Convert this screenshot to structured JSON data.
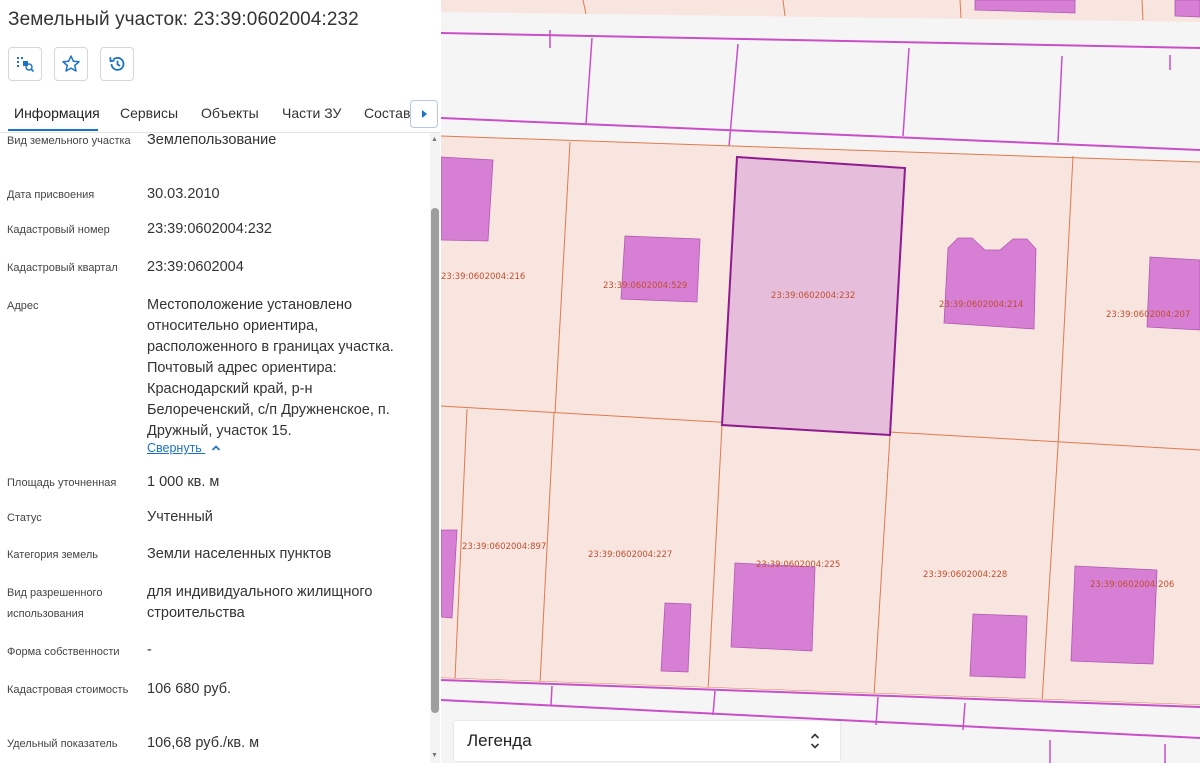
{
  "panel": {
    "title": "Земельный участок: 23:39:0602004:232",
    "tools": [
      {
        "icon": "zoom-to-object-icon"
      },
      {
        "icon": "star-icon"
      },
      {
        "icon": "history-icon"
      }
    ],
    "tabs": [
      {
        "label": "Информация",
        "active": true
      },
      {
        "label": "Сервисы"
      },
      {
        "label": "Объекты"
      },
      {
        "label": "Части ЗУ"
      },
      {
        "label": "Состав"
      }
    ],
    "fields": [
      {
        "label": "Вид земельного участка",
        "value": "Землепользование"
      },
      {
        "label": "Дата присвоения",
        "value": "30.03.2010"
      },
      {
        "label": "Кадастровый номер",
        "value": "23:39:0602004:232"
      },
      {
        "label": "Кадастровый квартал",
        "value": "23:39:0602004"
      },
      {
        "label": "Адрес",
        "value": "Местоположение установлено относительно ориентира, расположенного в границах участка. Почтовый адрес ориентира: Краснодарский край, р-н Белореченский, с/п Дружненское, п. Дружный, участок 15."
      },
      {
        "label": "Площадь уточненная",
        "value": "1 000 кв. м"
      },
      {
        "label": "Статус",
        "value": "Учтенный"
      },
      {
        "label": "Категория земель",
        "value": "Земли населенных пунктов"
      },
      {
        "label": "Вид разрешенного использования",
        "value": "для индивидуального жилищного строительства"
      },
      {
        "label": "Форма собственности",
        "value": "-"
      },
      {
        "label": "Кадастровая стоимость",
        "value": "106 680 руб."
      },
      {
        "label": "Удельный показатель",
        "value": "106,68 руб./кв. м"
      }
    ],
    "collapse_label": "Свернуть"
  },
  "map": {
    "parcel_labels": {
      "p216": "23:39:0602004:216",
      "p529": "23:39:0602004:529",
      "p232": "23:39:0602004:232",
      "p214": "23:39:0602004:214",
      "p207": "23:39:0602004:207",
      "p897": "23:39:0602004:897",
      "p227": "23:39:0602004:227",
      "p225": "23:39:0602004:225",
      "p228": "23:39:0602004:228",
      "p206": "23:39:0602004:206"
    },
    "legend_label": "Легенда"
  },
  "colors": {
    "accent": "#1a73c8",
    "parcel_fill": "#f8e5df",
    "parcel_border": "#e07a4e",
    "building_fill": "#d67fd4",
    "selected_fill": "#e6bedb",
    "selected_border": "#8e1a8e",
    "road_line": "#c94fc9"
  }
}
